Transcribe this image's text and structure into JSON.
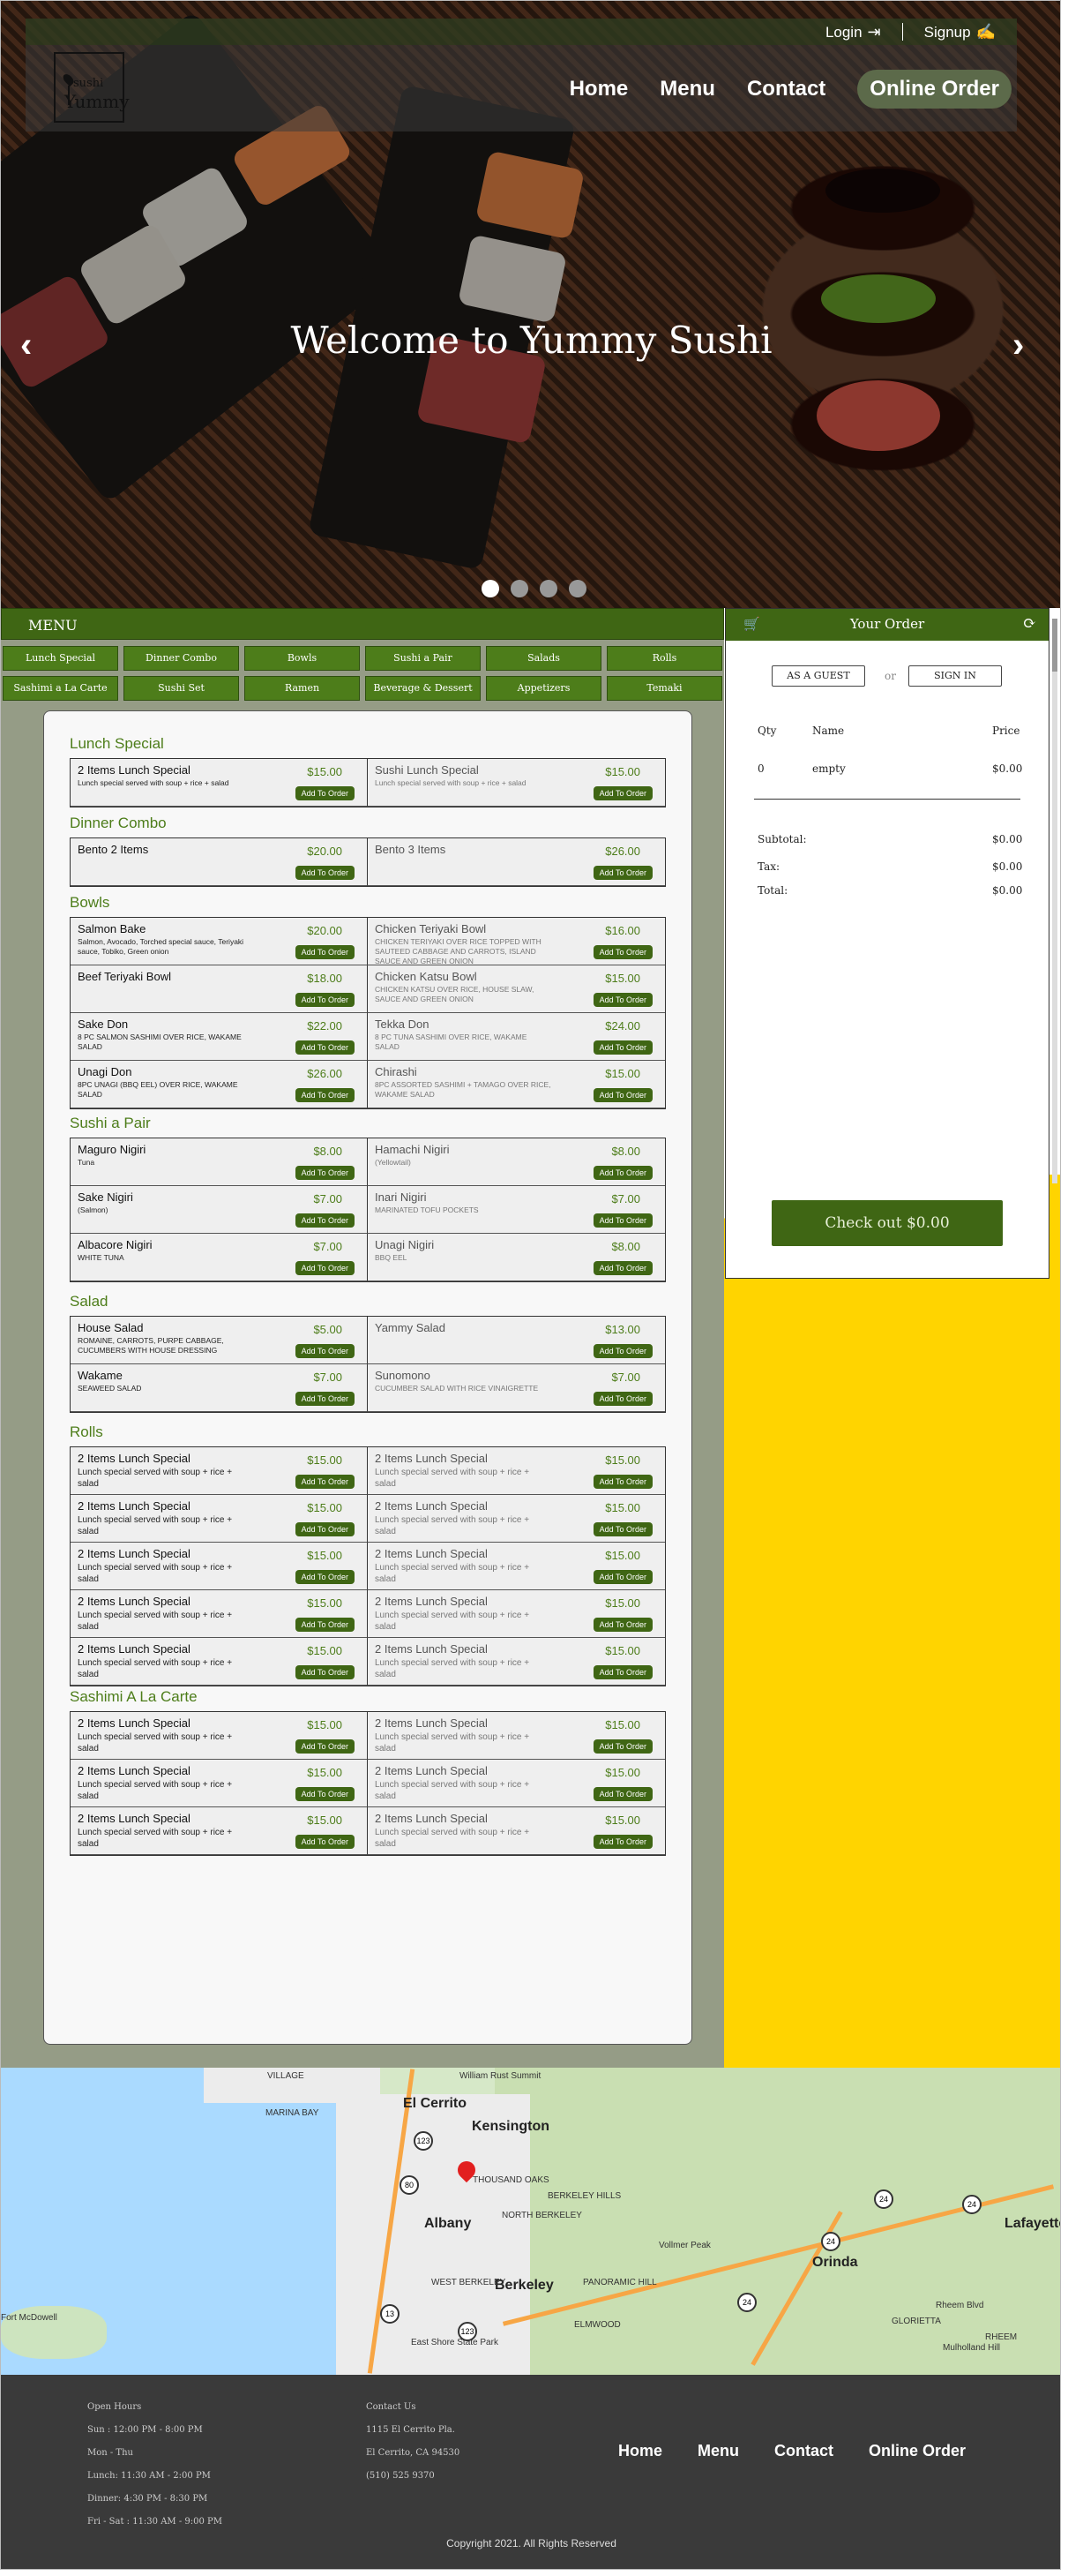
{
  "top": {
    "login": "Login",
    "signup": "Signup"
  },
  "logo": {
    "line1": "sushi",
    "line2": "Yummy"
  },
  "nav": [
    "Home",
    "Menu",
    "Contact",
    "Online Order"
  ],
  "hero": {
    "welcome": "Welcome to Yummy Sushi",
    "prev": "‹",
    "next": "›",
    "slides": 4,
    "active_slide": 1
  },
  "menu": {
    "title": "MENU",
    "categories": [
      "Lunch Special",
      "Dinner Combo",
      "Bowls",
      "Sushi a Pair",
      "Salads",
      "Rolls",
      "Sashimi a La Carte",
      "Sushi Set",
      "Ramen",
      "Beverage & Dessert",
      "Appetizers",
      "Temaki"
    ],
    "add_label": "Add To Order"
  },
  "sections": [
    {
      "title": "Lunch Special",
      "items": [
        {
          "name": "2 Items Lunch Special",
          "desc": "Lunch special served with soup + rice + salad",
          "price": "$15.00"
        },
        {
          "name": "Sushi Lunch Special",
          "desc": "Lunch special served with soup + rice + salad",
          "price": "$15.00"
        }
      ]
    },
    {
      "title": "Dinner Combo",
      "items": [
        {
          "name": "Bento 2 Items",
          "desc": "",
          "price": "$20.00"
        },
        {
          "name": "Bento 3 Items",
          "desc": "",
          "price": "$26.00"
        }
      ]
    },
    {
      "title": "Bowls",
      "items": [
        {
          "name": "Salmon Bake",
          "desc": "Salmon, Avocado, Torched special sauce, Teriyaki sauce, Tobiko, Green onion",
          "price": "$20.00"
        },
        {
          "name": "Chicken Teriyaki Bowl",
          "desc": "CHICKEN TERIYAKI OVER RICE TOPPED WITH SAUTEED CABBAGE AND CARROTS, ISLAND SAUCE AND GREEN ONION",
          "price": "$16.00"
        },
        {
          "name": "Beef Teriyaki Bowl",
          "desc": "",
          "price": "$18.00"
        },
        {
          "name": "Chicken Katsu Bowl",
          "desc": "CHICKEN KATSU OVER RICE, HOUSE SLAW, SAUCE AND GREEN ONION",
          "price": "$15.00"
        },
        {
          "name": "Sake Don",
          "desc": "8 PC SALMON SASHIMI OVER RICE, WAKAME SALAD",
          "price": "$22.00"
        },
        {
          "name": "Tekka Don",
          "desc": "8 PC TUNA SASHIMI OVER RICE, WAKAME SALAD",
          "price": "$24.00"
        },
        {
          "name": "Unagi Don",
          "desc": "8PC UNAGI (BBQ EEL) OVER RICE, WAKAME SALAD",
          "price": "$26.00"
        },
        {
          "name": "Chirashi",
          "desc": "8PC ASSORTED SASHIMI + TAMAGO OVER RICE, WAKAME SALAD",
          "price": "$15.00"
        }
      ]
    },
    {
      "title": "Sushi a Pair",
      "items": [
        {
          "name": "Maguro Nigiri",
          "desc": "Tuna",
          "price": "$8.00"
        },
        {
          "name": "Hamachi Nigiri",
          "desc": "(Yellowtail)",
          "price": "$8.00"
        },
        {
          "name": "Sake Nigiri",
          "desc": "(Salmon)",
          "price": "$7.00"
        },
        {
          "name": "Inari Nigiri",
          "desc": "MARINATED TOFU POCKETS",
          "price": "$7.00"
        },
        {
          "name": "Albacore Nigiri",
          "desc": "WHITE TUNA",
          "price": "$7.00"
        },
        {
          "name": "Unagi Nigiri",
          "desc": "BBQ EEL",
          "price": "$8.00"
        }
      ]
    },
    {
      "title": "Salad",
      "items": [
        {
          "name": "House Salad",
          "desc": "ROMAINE, CARROTS, PURPE CABBAGE, CUCUMBERS WITH HOUSE DRESSING",
          "price": "$5.00"
        },
        {
          "name": "Yammy Salad",
          "desc": "",
          "price": "$13.00"
        },
        {
          "name": "Wakame",
          "desc": "SEAWEED SALAD",
          "price": "$7.00"
        },
        {
          "name": "Sunomono",
          "desc": "CUCUMBER SALAD WITH RICE VINAIGRETTE",
          "price": "$7.00"
        }
      ]
    },
    {
      "title": "Rolls",
      "large": true,
      "items": [
        {
          "name": "2 Items Lunch Special",
          "desc": "Lunch special served with soup + rice + salad",
          "price": "$15.00"
        },
        {
          "name": "2 Items Lunch Special",
          "desc": "Lunch special served with soup + rice + salad",
          "price": "$15.00"
        },
        {
          "name": "2 Items Lunch Special",
          "desc": "Lunch special served with soup + rice + salad",
          "price": "$15.00"
        },
        {
          "name": "2 Items Lunch Special",
          "desc": "Lunch special served with soup + rice + salad",
          "price": "$15.00"
        },
        {
          "name": "2 Items Lunch Special",
          "desc": "Lunch special served with soup + rice + salad",
          "price": "$15.00"
        },
        {
          "name": "2 Items Lunch Special",
          "desc": "Lunch special served with soup + rice + salad",
          "price": "$15.00"
        },
        {
          "name": "2 Items Lunch Special",
          "desc": "Lunch special served with soup + rice + salad",
          "price": "$15.00"
        },
        {
          "name": "2 Items Lunch Special",
          "desc": "Lunch special served with soup + rice + salad",
          "price": "$15.00"
        },
        {
          "name": "2 Items Lunch Special",
          "desc": "Lunch special served with soup + rice + salad",
          "price": "$15.00"
        },
        {
          "name": "2 Items Lunch Special",
          "desc": "Lunch special served with soup + rice + salad",
          "price": "$15.00"
        }
      ]
    },
    {
      "title": "Sashimi A La Carte",
      "large": true,
      "items": [
        {
          "name": "2 Items Lunch Special",
          "desc": "Lunch special served with soup + rice + salad",
          "price": "$15.00"
        },
        {
          "name": "2 Items Lunch Special",
          "desc": "Lunch special served with soup + rice + salad",
          "price": "$15.00"
        },
        {
          "name": "2 Items Lunch Special",
          "desc": "Lunch special served with soup + rice + salad",
          "price": "$15.00"
        },
        {
          "name": "2 Items Lunch Special",
          "desc": "Lunch special served with soup + rice + salad",
          "price": "$15.00"
        },
        {
          "name": "2 Items Lunch Special",
          "desc": "Lunch special served with soup + rice + salad",
          "price": "$15.00"
        },
        {
          "name": "2 Items Lunch Special",
          "desc": "Lunch special served with soup + rice + salad",
          "price": "$15.00"
        }
      ]
    }
  ],
  "order": {
    "title": "Your Order",
    "guest": "AS A GUEST",
    "or": "or",
    "signin": "SIGN IN",
    "col_qty": "Qty",
    "col_name": "Name",
    "col_price": "Price",
    "row_qty": "0",
    "row_name": "empty",
    "row_price": "$0.00",
    "subtotal_label": "Subtotal:",
    "subtotal": "$0.00",
    "tax_label": "Tax:",
    "tax": "$0.00",
    "total_label": "Total:",
    "total": "$0.00",
    "checkout": "Check out   $0.00"
  },
  "map": {
    "labels": [
      "El Cerrito",
      "Kensington",
      "Albany",
      "Berkeley",
      "Orinda",
      "Lafayette",
      "THOUSAND OAKS",
      "BERKELEY HILLS",
      "NORTH BERKELEY",
      "WEST BERKELEY",
      "PANORAMIC HILL",
      "ELMWOOD",
      "Vollmer Peak",
      "Fort McDowell",
      "East Shore State Park",
      "MARINA BAY",
      "William Rust Summit",
      "GLORIETTA",
      "RHEEM",
      "Mulholland Hill",
      "Rheem Blvd",
      "VILLAGE"
    ],
    "shields": [
      "123",
      "80",
      "123",
      "24",
      "24",
      "24",
      "24",
      "13"
    ]
  },
  "footer": {
    "hours_title": "Open Hours",
    "hours": [
      "Sun : 12:00 PM - 8:00 PM",
      "Mon - Thu",
      "Lunch: 11:30 AM - 2:00 PM",
      "Dinner: 4:30 PM - 8:30 PM",
      "Fri - Sat : 11:30 AM - 9:00 PM"
    ],
    "contact_title": "Contact Us",
    "contact": [
      "1115 El Cerrito Pla.",
      "El Cerrito, CA 94530",
      "(510) 525 9370"
    ],
    "nav": [
      "Home",
      "Menu",
      "Contact",
      "Online Order"
    ],
    "copyright": "Copyright 2021. All Rights Reserved"
  },
  "colors": {
    "brand_green": "#3f6614",
    "accent_yellow": "#ffd400",
    "footer_bg": "#3a3a3a"
  }
}
